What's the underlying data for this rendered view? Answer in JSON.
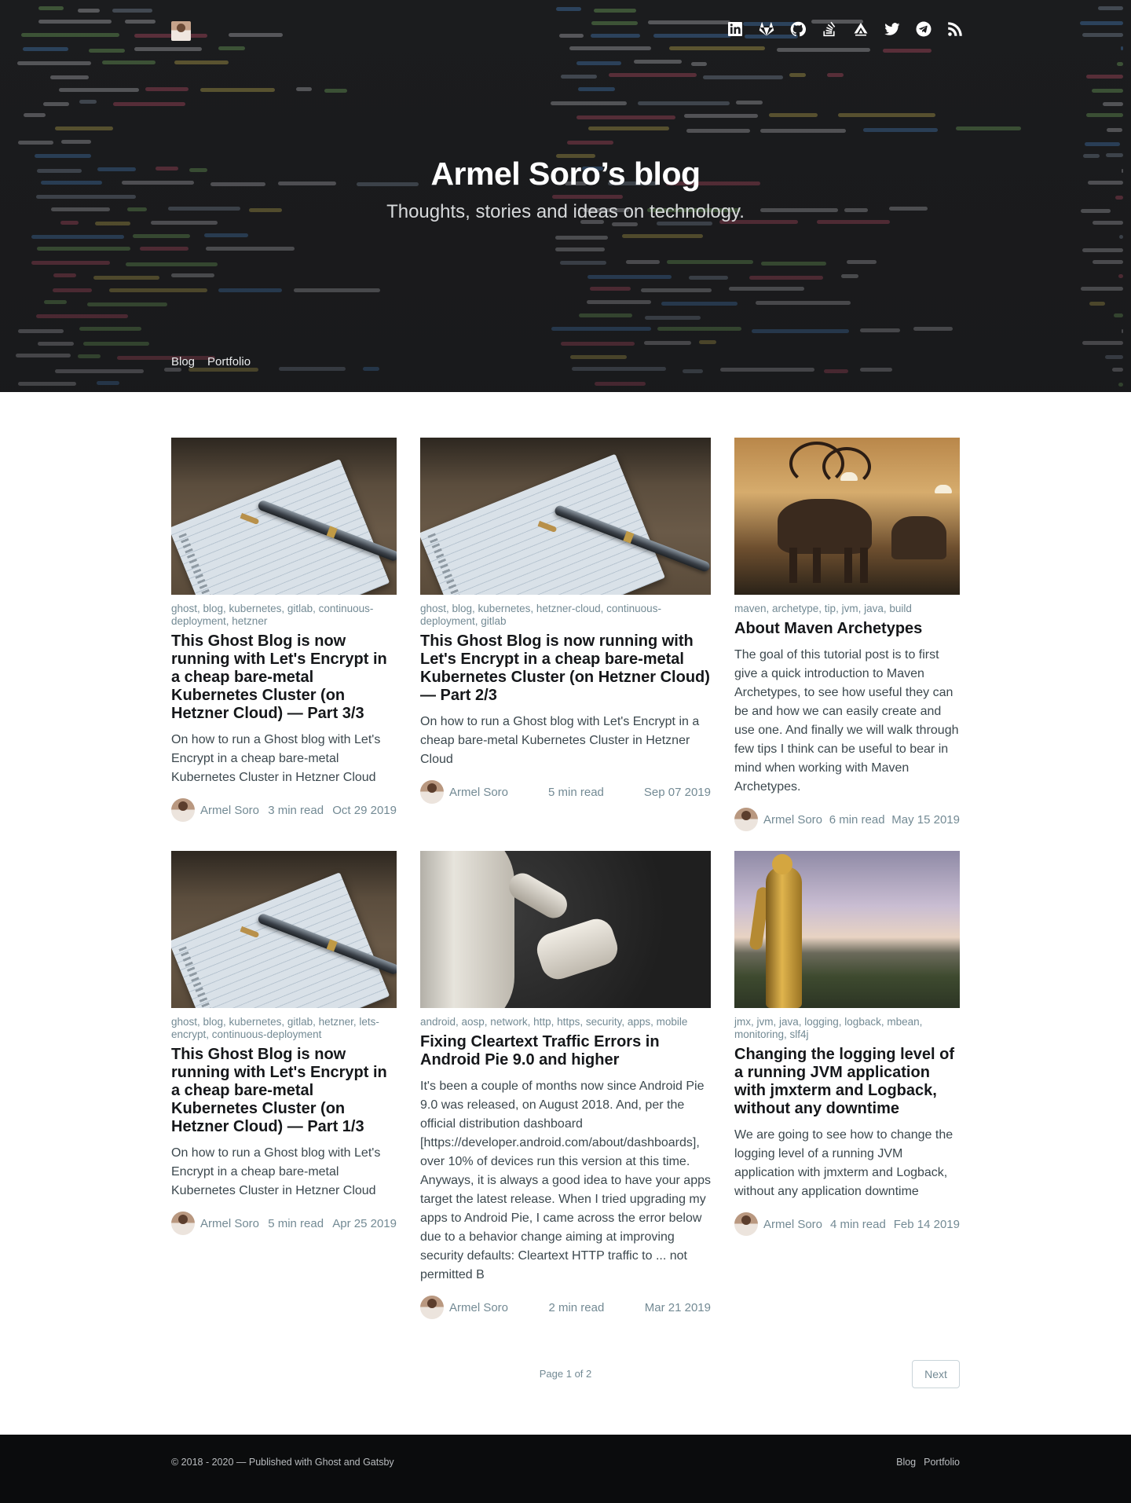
{
  "header": {
    "title": "Armel Soro’s blog",
    "description": "Thoughts, stories and ideas on technology.",
    "social": [
      {
        "icon": "linkedin-icon"
      },
      {
        "icon": "gitlab-icon"
      },
      {
        "icon": "github-icon"
      },
      {
        "icon": "stackoverflow-icon"
      },
      {
        "icon": "gitlab-alt-icon"
      },
      {
        "icon": "twitter-icon"
      },
      {
        "icon": "telegram-icon"
      },
      {
        "icon": "rss-icon"
      }
    ],
    "nav": [
      "Blog",
      "Portfolio"
    ]
  },
  "posts": [
    {
      "tags": "ghost, blog, kubernetes, gitlab, continuous-deployment, hetzner",
      "title": "This Ghost Blog is now running with Let's Encrypt in a cheap bare-metal Kubernetes Cluster (on Hetzner Cloud) — Part 3/3",
      "excerpt": "On how to run a Ghost blog with Let's Encrypt in a cheap bare-metal Kubernetes Cluster in Hetzner Cloud",
      "author": "Armel Soro",
      "read_time": "3 min read",
      "date": "Oct 29 2019",
      "image": "notebook-pen"
    },
    {
      "tags": "ghost, blog, kubernetes, hetzner-cloud, continuous-deployment, gitlab",
      "title": "This Ghost Blog is now running with Let's Encrypt in a cheap bare-metal Kubernetes Cluster (on Hetzner Cloud) — Part 2/3",
      "excerpt": "On how to run a Ghost blog with Let's Encrypt in a cheap bare-metal Kubernetes Cluster in Hetzner Cloud",
      "author": "Armel Soro",
      "read_time": "5 min read",
      "date": "Sep 07 2019",
      "image": "notebook-pen"
    },
    {
      "tags": "maven, archetype, tip, jvm, java, build",
      "title": "About Maven Archetypes",
      "excerpt": "The goal of this tutorial post is to first give a quick introduction to Maven Archetypes, to see how useful they can be and how we can easily create and use one. And finally we will walk through few tips I think can be useful to bear in mind when working with Maven Archetypes.",
      "author": "Armel Soro",
      "read_time": "6 min read",
      "date": "May 15 2019",
      "image": "museum"
    },
    {
      "tags": "ghost, blog, kubernetes, gitlab, hetzner, lets-encrypt, continuous-deployment",
      "title": "This Ghost Blog is now running with Let's Encrypt in a cheap bare-metal Kubernetes Cluster (on Hetzner Cloud) — Part 1/3",
      "excerpt": "On how to run a Ghost blog with Let's Encrypt in a cheap bare-metal Kubernetes Cluster in Hetzner Cloud",
      "author": "Armel Soro",
      "read_time": "5 min read",
      "date": "Apr 25 2019",
      "image": "notebook-pen"
    },
    {
      "tags": "android, aosp, network, http, https, security, apps, mobile",
      "title": "Fixing Cleartext Traffic Errors in Android Pie 9.0 and higher",
      "excerpt": "It's been a couple of months now since Android Pie 9.0 was released, on August 2018. And, per the official distribution dashboard [https://developer.android.com/about/dashboards], over 10% of devices run this version at this time. Anyways, it is always a good idea to have your apps target the latest release. When I tried upgrading my apps to Android Pie, I came across the error below due to a behavior change aiming at improving security defaults: Cleartext HTTP traffic to ... not permitted B",
      "author": "Armel Soro",
      "read_time": "2 min read",
      "date": "Mar 21 2019",
      "image": "robot-hand"
    },
    {
      "tags": "jmx, jvm, java, logging, logback, mbean, monitoring, slf4j",
      "title": "Changing the logging level of a running JVM application with jmxterm and Logback, without any downtime",
      "excerpt": "We are going to see how to change the logging level of a running JVM application with jmxterm and Logback, without any application downtime",
      "author": "Armel Soro",
      "read_time": "4 min read",
      "date": "Feb 14 2019",
      "image": "golden-statue"
    }
  ],
  "pagination": {
    "page": "Page 1 of 2",
    "next": "Next"
  },
  "footer": {
    "copyright": "© 2018 - 2020 — Published with Ghost  and Gatsby",
    "nav": [
      "Blog",
      "Portfolio"
    ]
  }
}
